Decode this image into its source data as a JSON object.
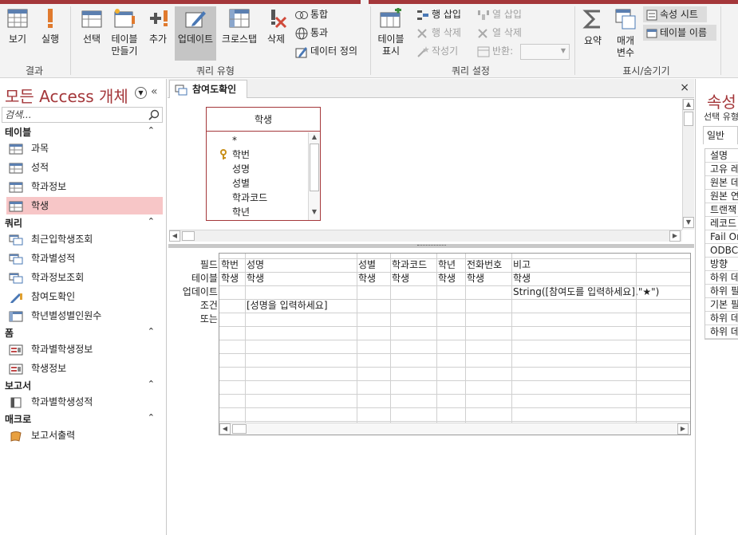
{
  "ribbon": {
    "groups": {
      "results": "결과",
      "query_type": "쿼리 유형",
      "query_setup": "쿼리 설정",
      "show_hide": "표시/숨기기"
    },
    "view": "보기",
    "run": "실행",
    "select": "선택",
    "make_table_l1": "테이블",
    "make_table_l2": "만들기",
    "append": "추가",
    "update": "업데이트",
    "crosstab": "크로스탭",
    "delete": "삭제",
    "union": "통합",
    "passthrough": "통과",
    "data_def": "데이터 정의",
    "show_table_l1": "테이블",
    "show_table_l2": "표시",
    "insert_rows": "행 삽입",
    "delete_rows": "행 삭제",
    "builder": "작성기",
    "insert_cols": "열 삽입",
    "delete_cols": "열 삭제",
    "return": "반환:",
    "totals": "요약",
    "params_l1": "매개",
    "params_l2": "변수",
    "property_sheet": "속성 시트",
    "table_names": "테이블 이름"
  },
  "nav": {
    "title": "모든 Access 개체",
    "search_placeholder": "검색...",
    "sections": {
      "tables": "테이블",
      "queries": "쿼리",
      "forms": "폼",
      "reports": "보고서",
      "macros": "매크로"
    },
    "tables": [
      "과목",
      "성적",
      "학과정보",
      "학생"
    ],
    "queries": [
      "최근입학생조회",
      "학과별성적",
      "학과정보조회",
      "참여도확인",
      "학년별성별인원수"
    ],
    "forms": [
      "학과별학생정보",
      "학생정보"
    ],
    "reports": [
      "학과별학생성적"
    ],
    "macros": [
      "보고서출력"
    ]
  },
  "tab": {
    "title": "참여도확인",
    "close": "×"
  },
  "table_box": {
    "name": "학생",
    "fields": [
      "*",
      "학번",
      "성명",
      "성별",
      "학과코드",
      "학년"
    ]
  },
  "grid": {
    "row_labels": {
      "field": "필드:",
      "table": "테이블:",
      "update": "업데이트:",
      "criteria": "조건:",
      "or": "또는:"
    },
    "columns": [
      {
        "field": "학번",
        "table": "학생",
        "update": "",
        "criteria": ""
      },
      {
        "field": "성명",
        "table": "학생",
        "update": "",
        "criteria": "[성명을 입력하세요]"
      },
      {
        "field": "성별",
        "table": "학생",
        "update": "",
        "criteria": ""
      },
      {
        "field": "학과코드",
        "table": "학생",
        "update": "",
        "criteria": ""
      },
      {
        "field": "학년",
        "table": "학생",
        "update": "",
        "criteria": ""
      },
      {
        "field": "전화번호",
        "table": "학생",
        "update": "",
        "criteria": ""
      },
      {
        "field": "비고",
        "table": "학생",
        "update": "String([참여도를 입력하세요],\"★\")",
        "criteria": ""
      }
    ]
  },
  "props": {
    "title": "속성",
    "selection_label": "선택 유형",
    "tab_general": "일반",
    "rows": [
      "설명",
      "고유 레",
      "원본 데",
      "원본 연",
      "트랜잭",
      "레코드",
      "Fail On",
      "ODBC",
      "방향",
      "하위 데",
      "하위 필",
      "기본 필",
      "하위 데",
      "하위 데"
    ]
  },
  "colors": {
    "accent": "#a4373a",
    "selected_item": "#f7c6c7"
  }
}
